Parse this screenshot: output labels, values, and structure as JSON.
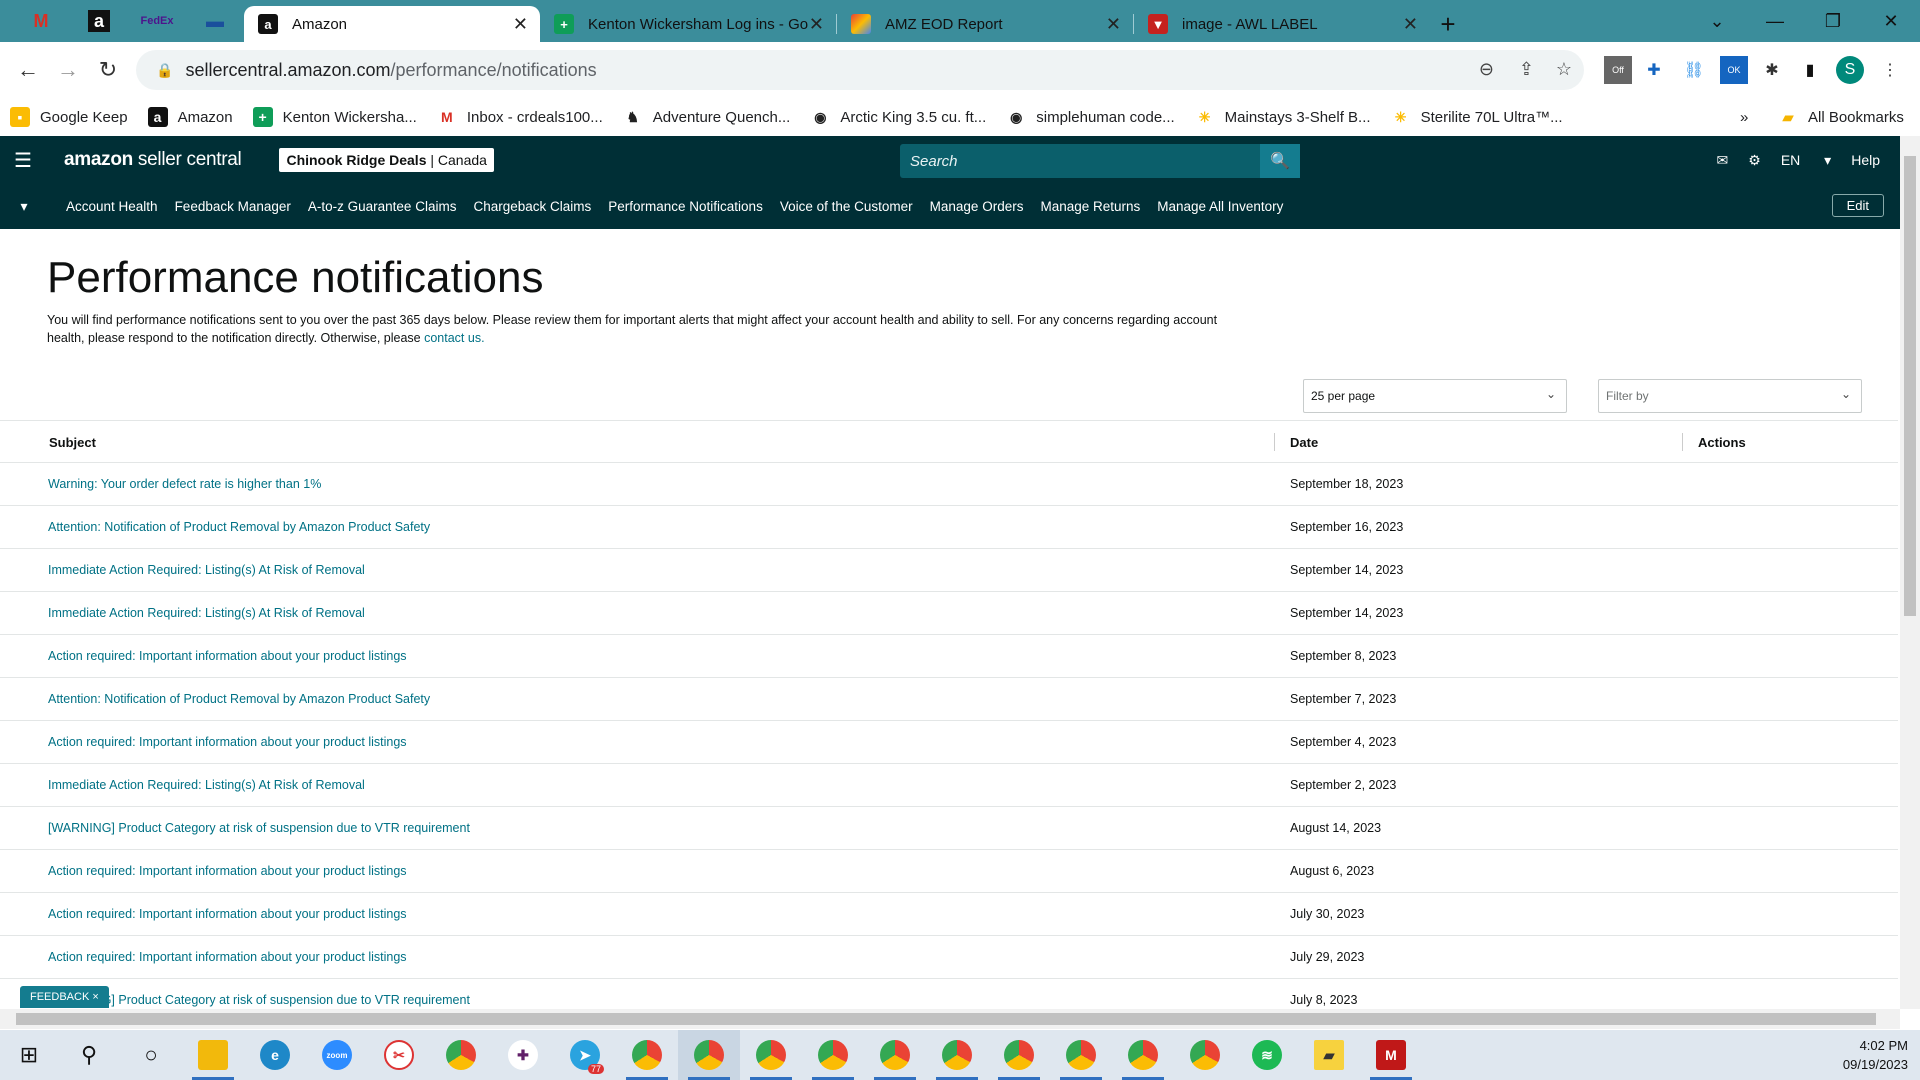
{
  "browser": {
    "tabs": [
      {
        "title": "Amazon",
        "icon": "amazon-icon",
        "active": true
      },
      {
        "title": "Kenton Wickersham Log ins - Go",
        "icon": "sheets-icon"
      },
      {
        "title": "AMZ EOD Report",
        "icon": "report-icon"
      },
      {
        "title": "image - AWL LABEL",
        "icon": "label-icon"
      }
    ],
    "url_host": "sellercentral.amazon.com",
    "url_path": "/performance/notifications",
    "bookmarks": [
      "Google Keep",
      "Amazon",
      "Kenton Wickersha...",
      "Inbox - crdeals100...",
      "Adventure Quench...",
      "Arctic King 3.5 cu. ft...",
      "simplehuman code...",
      "Mainstays 3-Shelf B...",
      "Sterilite 70L Ultra™..."
    ],
    "all_bookmarks": "All Bookmarks",
    "profile_initial": "S",
    "chevrons": "»"
  },
  "header": {
    "brand_bold": "amazon",
    "brand_rest": " seller central",
    "store_name": "Chinook Ridge Deals",
    "store_region": "| Canada",
    "search_placeholder": "Search",
    "language": "EN",
    "help": "Help"
  },
  "nav": {
    "items": [
      "Account Health",
      "Feedback Manager",
      "A-to-z Guarantee Claims",
      "Chargeback Claims",
      "Performance Notifications",
      "Voice of the Customer",
      "Manage Orders",
      "Manage Returns",
      "Manage All Inventory"
    ],
    "edit": "Edit"
  },
  "page": {
    "title": "Performance notifications",
    "description": "You will find performance notifications sent to you over the past 365 days below. Please review them for important alerts that might affect your account health and ability to sell. For any concerns regarding account health, please respond to the notification directly. Otherwise, please",
    "contact_link": "contact us.",
    "per_page": "25 per page",
    "filter_placeholder": "Filter by"
  },
  "table": {
    "headers": {
      "subject": "Subject",
      "date": "Date",
      "actions": "Actions"
    },
    "rows": [
      {
        "subject": "Warning: Your order defect rate is higher than 1%",
        "date": "September 18, 2023"
      },
      {
        "subject": "Attention: Notification of Product Removal by Amazon Product Safety",
        "date": "September 16, 2023"
      },
      {
        "subject": "Immediate Action Required: Listing(s) At Risk of Removal",
        "date": "September 14, 2023"
      },
      {
        "subject": "Immediate Action Required: Listing(s) At Risk of Removal",
        "date": "September 14, 2023"
      },
      {
        "subject": "Action required: Important information about your product listings",
        "date": "September 8, 2023"
      },
      {
        "subject": "Attention: Notification of Product Removal by Amazon Product Safety",
        "date": "September 7, 2023"
      },
      {
        "subject": "Action required: Important information about your product listings",
        "date": "September 4, 2023"
      },
      {
        "subject": "Immediate Action Required: Listing(s) At Risk of Removal",
        "date": "September 2, 2023"
      },
      {
        "subject": "[WARNING] Product Category at risk of suspension due to VTR requirement",
        "date": "August 14, 2023"
      },
      {
        "subject": "Action required: Important information about your product listings",
        "date": "August 6, 2023"
      },
      {
        "subject": "Action required: Important information about your product listings",
        "date": "July 30, 2023"
      },
      {
        "subject": "Action required: Important information about your product listings",
        "date": "July 29, 2023"
      },
      {
        "subject": "[WARNING] Product Category at risk of suspension due to VTR requirement",
        "date": "July 8, 2023"
      }
    ]
  },
  "feedback": {
    "label": "FEEDBACK",
    "close": "×"
  },
  "taskbar": {
    "telegram_badge": "77",
    "time": "4:02 PM",
    "date": "09/19/2023"
  },
  "colors": {
    "header_bg": "#002f36",
    "link": "#007185",
    "tabbar": "#3b8d9b"
  }
}
